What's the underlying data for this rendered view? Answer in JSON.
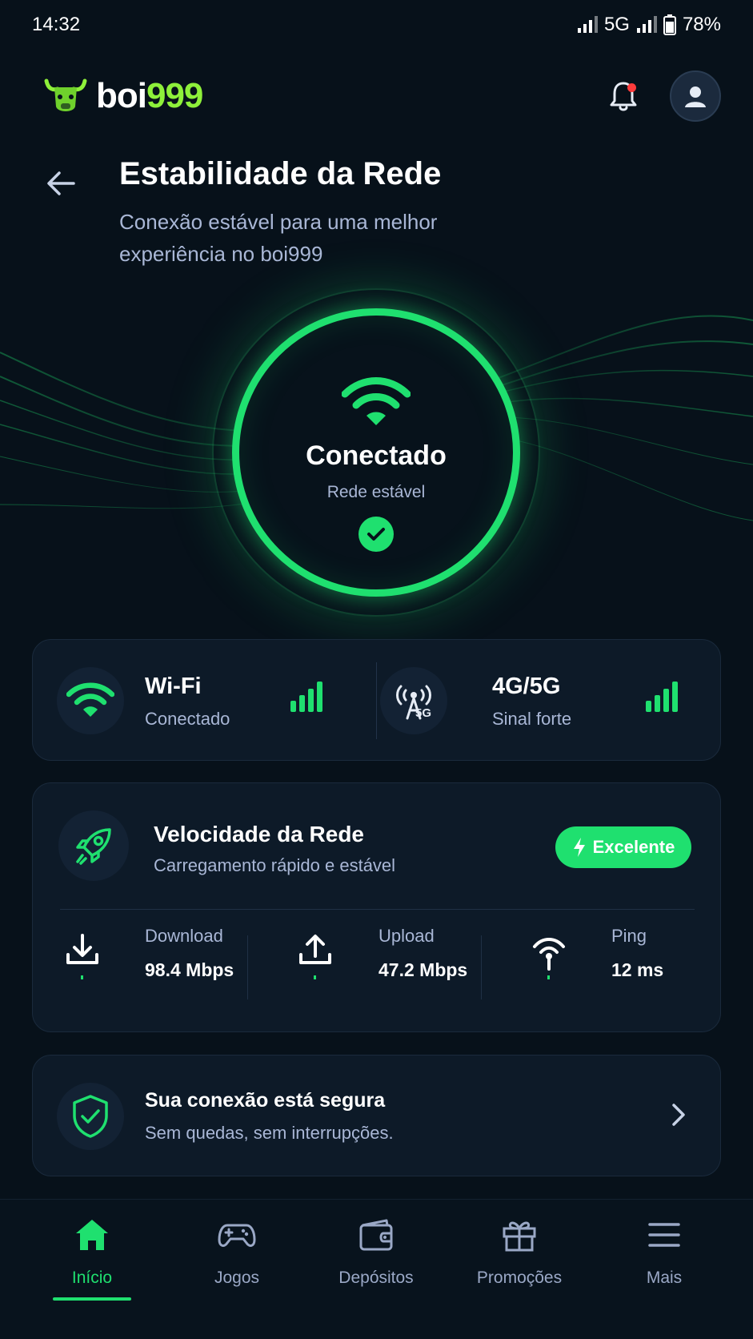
{
  "status_bar": {
    "time": "14:32",
    "network": "5G",
    "battery": "78%"
  },
  "header": {
    "logo_part1": "boi",
    "logo_part2": "999"
  },
  "page": {
    "title": "Estabilidade da Rede",
    "subtitle": "Conexão estável para uma melhor experiência no boi999"
  },
  "connection_ring": {
    "status": "Conectado",
    "detail": "Rede estável"
  },
  "connections": [
    {
      "title": "Wi-Fi",
      "status": "Conectado",
      "icon": "wifi-icon"
    },
    {
      "title": "4G/5G",
      "status": "Sinal forte",
      "icon": "cell-tower-5g-icon",
      "tower_label": "5G"
    }
  ],
  "speed": {
    "title": "Velocidade da Rede",
    "subtitle": "Carregamento rápido e estável",
    "badge": "Excelente",
    "metrics": [
      {
        "label": "Download",
        "value": "98.4 Mbps",
        "icon": "download-icon"
      },
      {
        "label": "Upload",
        "value": "47.2 Mbps",
        "icon": "upload-icon"
      },
      {
        "label": "Ping",
        "value": "12 ms",
        "icon": "ping-icon"
      }
    ]
  },
  "security": {
    "title": "Sua conexão está segura",
    "subtitle": "Sem quedas, sem interrupções."
  },
  "nav": {
    "active": "Início",
    "items": [
      {
        "label": "Início",
        "icon": "home-icon"
      },
      {
        "label": "Jogos",
        "icon": "gamepad-icon"
      },
      {
        "label": "Depósitos",
        "icon": "wallet-icon"
      },
      {
        "label": "Promoções",
        "icon": "gift-icon"
      },
      {
        "label": "Mais",
        "icon": "menu-icon"
      }
    ]
  },
  "colors": {
    "background": "#07111a",
    "card": "#0d1a28",
    "accent_green": "#1fe06f",
    "logo_green": "#8ef03a",
    "text_muted": "#a9b7d6",
    "notification_dot": "#ff3b3b"
  }
}
